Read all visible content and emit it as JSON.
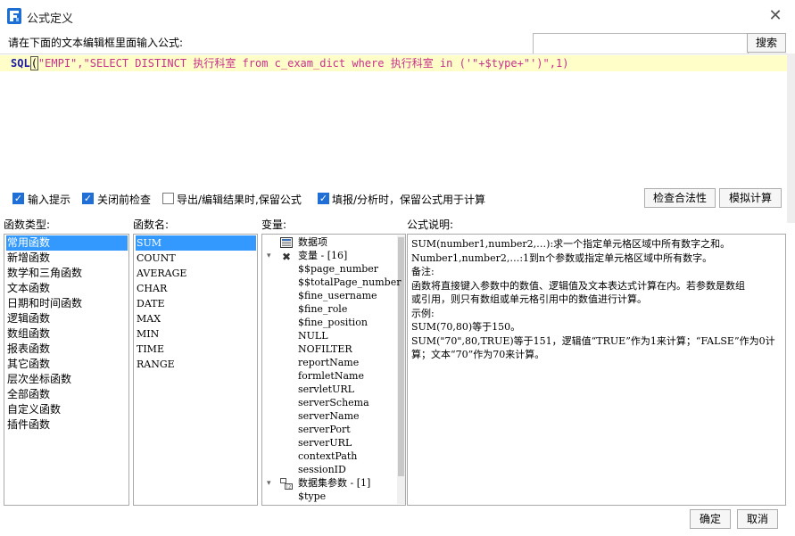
{
  "window": {
    "title": "公式定义",
    "close_glyph": "✕"
  },
  "prompt": "请在下面的文本编辑框里面输入公式:",
  "search": {
    "value": "",
    "button_label": "搜索"
  },
  "editor": {
    "code_keyword": "SQL",
    "code_paren_open": "(",
    "code_string": "\"EMPI\",\"SELECT DISTINCT 执行科室 from c_exam_dict where 执行科室 in ('\"+$type+\"')\",1)"
  },
  "options": {
    "input_hint": {
      "label": "输入提示",
      "checked": true
    },
    "check_before_close": {
      "label": "关闭前检查",
      "checked": true
    },
    "keep_formula_export": {
      "label": "导出/编辑结果时,保留公式",
      "checked": false
    },
    "keep_formula_calc": {
      "label": "填报/分析时，保留公式用于计算",
      "checked": true
    },
    "validate_button": "检查合法性",
    "simulate_button": "模拟计算"
  },
  "labels": {
    "function_type": "函数类型:",
    "function_name": "函数名:",
    "variable": "变量:",
    "formula_desc": "公式说明:"
  },
  "function_types": [
    "常用函数",
    "新增函数",
    "数学和三角函数",
    "文本函数",
    "日期和时间函数",
    "逻辑函数",
    "数组函数",
    "报表函数",
    "其它函数",
    "层次坐标函数",
    "全部函数",
    "自定义函数",
    "插件函数"
  ],
  "function_names": [
    "SUM",
    "COUNT",
    "AVERAGE",
    "CHAR",
    "DATE",
    "MAX",
    "MIN",
    "TIME",
    "RANGE"
  ],
  "variables": {
    "root": "数据项",
    "group1_label": "变量 - [16]",
    "group1_items": [
      "$$page_number",
      "$$totalPage_number",
      "$fine_username",
      "$fine_role",
      "$fine_position",
      "NULL",
      "NOFILTER",
      "reportName",
      "formletName",
      "servletURL",
      "serverSchema",
      "serverName",
      "serverPort",
      "serverURL",
      "contextPath",
      "sessionID"
    ],
    "group2_label": "数据集参数 - [1]",
    "group2_items": [
      "$type"
    ]
  },
  "description": {
    "lines": [
      "SUM(number1,number2,…):求一个指定单元格区域中所有数字之和。",
      "Number1,number2,…:1到n个参数或指定单元格区域中所有数字。",
      "备注:",
      "函数将直接键入参数中的数值、逻辑值及文本表达式计算在内。若参数是数组",
      "或引用，则只有数组或单元格引用中的数值进行计算。",
      "示例:",
      "SUM(70,80)等于150。",
      "SUM(\"70\",80,TRUE)等于151，逻辑值“TRUE”作为1来计算；“FALSE”作为0计",
      "算；文本“70”作为70来计算。"
    ]
  },
  "footer": {
    "ok_label": "确定",
    "cancel_label": "取消"
  },
  "colors": {
    "selection": "#3399ff",
    "editor_highlight": "#fffdc8",
    "checkbox": "#1f6fd6"
  }
}
